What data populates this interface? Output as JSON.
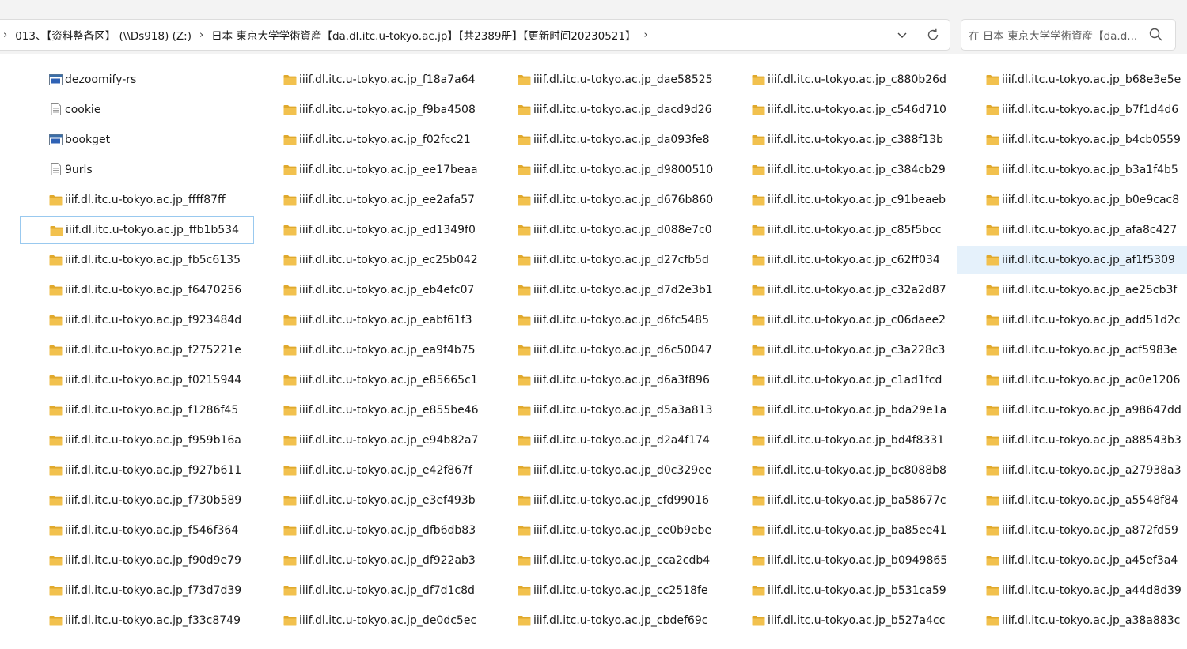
{
  "window": {
    "corner_mark": ""
  },
  "address": {
    "segments": [
      "013、【资料整备区】 (\\\\Ds918) (Z:)",
      "日本 東京大学学術資産【da.dl.itc.u-tokyo.ac.jp】【共2389册】【更新时间20230521】"
    ],
    "lead_sep": "›",
    "sep": "›",
    "trail_sep": "›"
  },
  "search": {
    "placeholder": "在 日本 東京大学学術資産【da.d..."
  },
  "colors": {
    "folder": "#f2c14e",
    "folder_dark": "#e0a92c",
    "hover_bg": "#e5f1fb",
    "focus_border": "#99c9ef"
  },
  "columns": [
    [
      {
        "name": "dezoomify-rs",
        "icon": "app-icon"
      },
      {
        "name": "cookie",
        "icon": "text-file-icon"
      },
      {
        "name": "bookget",
        "icon": "app-icon"
      },
      {
        "name": "9urls",
        "icon": "text-file-icon"
      },
      {
        "name": "iiif.dl.itc.u-tokyo.ac.jp_ffff87ff",
        "icon": "folder-icon"
      },
      {
        "name": "iiif.dl.itc.u-tokyo.ac.jp_ffb1b534",
        "icon": "folder-icon",
        "state": "focused"
      },
      {
        "name": "iiif.dl.itc.u-tokyo.ac.jp_fb5c6135",
        "icon": "folder-icon"
      },
      {
        "name": "iiif.dl.itc.u-tokyo.ac.jp_f6470256",
        "icon": "folder-icon"
      },
      {
        "name": "iiif.dl.itc.u-tokyo.ac.jp_f923484d",
        "icon": "folder-icon"
      },
      {
        "name": "iiif.dl.itc.u-tokyo.ac.jp_f275221e",
        "icon": "folder-icon"
      },
      {
        "name": "iiif.dl.itc.u-tokyo.ac.jp_f0215944",
        "icon": "folder-icon"
      },
      {
        "name": "iiif.dl.itc.u-tokyo.ac.jp_f1286f45",
        "icon": "folder-icon"
      },
      {
        "name": "iiif.dl.itc.u-tokyo.ac.jp_f959b16a",
        "icon": "folder-icon"
      },
      {
        "name": "iiif.dl.itc.u-tokyo.ac.jp_f927b611",
        "icon": "folder-icon"
      },
      {
        "name": "iiif.dl.itc.u-tokyo.ac.jp_f730b589",
        "icon": "folder-icon"
      },
      {
        "name": "iiif.dl.itc.u-tokyo.ac.jp_f546f364",
        "icon": "folder-icon"
      },
      {
        "name": "iiif.dl.itc.u-tokyo.ac.jp_f90d9e79",
        "icon": "folder-icon"
      },
      {
        "name": "iiif.dl.itc.u-tokyo.ac.jp_f73d7d39",
        "icon": "folder-icon"
      },
      {
        "name": "iiif.dl.itc.u-tokyo.ac.jp_f33c8749",
        "icon": "folder-icon"
      }
    ],
    [
      {
        "name": "iiif.dl.itc.u-tokyo.ac.jp_f18a7a64",
        "icon": "folder-icon"
      },
      {
        "name": "iiif.dl.itc.u-tokyo.ac.jp_f9ba4508",
        "icon": "folder-icon"
      },
      {
        "name": "iiif.dl.itc.u-tokyo.ac.jp_f02fcc21",
        "icon": "folder-icon"
      },
      {
        "name": "iiif.dl.itc.u-tokyo.ac.jp_ee17beaa",
        "icon": "folder-icon"
      },
      {
        "name": "iiif.dl.itc.u-tokyo.ac.jp_ee2afa57",
        "icon": "folder-icon"
      },
      {
        "name": "iiif.dl.itc.u-tokyo.ac.jp_ed1349f0",
        "icon": "folder-icon"
      },
      {
        "name": "iiif.dl.itc.u-tokyo.ac.jp_ec25b042",
        "icon": "folder-icon"
      },
      {
        "name": "iiif.dl.itc.u-tokyo.ac.jp_eb4efc07",
        "icon": "folder-icon"
      },
      {
        "name": "iiif.dl.itc.u-tokyo.ac.jp_eabf61f3",
        "icon": "folder-icon"
      },
      {
        "name": "iiif.dl.itc.u-tokyo.ac.jp_ea9f4b75",
        "icon": "folder-icon"
      },
      {
        "name": "iiif.dl.itc.u-tokyo.ac.jp_e85665c1",
        "icon": "folder-icon"
      },
      {
        "name": "iiif.dl.itc.u-tokyo.ac.jp_e855be46",
        "icon": "folder-icon"
      },
      {
        "name": "iiif.dl.itc.u-tokyo.ac.jp_e94b82a7",
        "icon": "folder-icon"
      },
      {
        "name": "iiif.dl.itc.u-tokyo.ac.jp_e42f867f",
        "icon": "folder-icon"
      },
      {
        "name": "iiif.dl.itc.u-tokyo.ac.jp_e3ef493b",
        "icon": "folder-icon"
      },
      {
        "name": "iiif.dl.itc.u-tokyo.ac.jp_dfb6db83",
        "icon": "folder-icon"
      },
      {
        "name": "iiif.dl.itc.u-tokyo.ac.jp_df922ab3",
        "icon": "folder-icon"
      },
      {
        "name": "iiif.dl.itc.u-tokyo.ac.jp_df7d1c8d",
        "icon": "folder-icon"
      },
      {
        "name": "iiif.dl.itc.u-tokyo.ac.jp_de0dc5ec",
        "icon": "folder-icon"
      }
    ],
    [
      {
        "name": "iiif.dl.itc.u-tokyo.ac.jp_dae58525",
        "icon": "folder-icon"
      },
      {
        "name": "iiif.dl.itc.u-tokyo.ac.jp_dacd9d26",
        "icon": "folder-icon"
      },
      {
        "name": "iiif.dl.itc.u-tokyo.ac.jp_da093fe8",
        "icon": "folder-icon"
      },
      {
        "name": "iiif.dl.itc.u-tokyo.ac.jp_d9800510",
        "icon": "folder-icon"
      },
      {
        "name": "iiif.dl.itc.u-tokyo.ac.jp_d676b860",
        "icon": "folder-icon"
      },
      {
        "name": "iiif.dl.itc.u-tokyo.ac.jp_d088e7c0",
        "icon": "folder-icon"
      },
      {
        "name": "iiif.dl.itc.u-tokyo.ac.jp_d27cfb5d",
        "icon": "folder-icon"
      },
      {
        "name": "iiif.dl.itc.u-tokyo.ac.jp_d7d2e3b1",
        "icon": "folder-icon"
      },
      {
        "name": "iiif.dl.itc.u-tokyo.ac.jp_d6fc5485",
        "icon": "folder-icon"
      },
      {
        "name": "iiif.dl.itc.u-tokyo.ac.jp_d6c50047",
        "icon": "folder-icon"
      },
      {
        "name": "iiif.dl.itc.u-tokyo.ac.jp_d6a3f896",
        "icon": "folder-icon"
      },
      {
        "name": "iiif.dl.itc.u-tokyo.ac.jp_d5a3a813",
        "icon": "folder-icon"
      },
      {
        "name": "iiif.dl.itc.u-tokyo.ac.jp_d2a4f174",
        "icon": "folder-icon"
      },
      {
        "name": "iiif.dl.itc.u-tokyo.ac.jp_d0c329ee",
        "icon": "folder-icon"
      },
      {
        "name": "iiif.dl.itc.u-tokyo.ac.jp_cfd99016",
        "icon": "folder-icon"
      },
      {
        "name": "iiif.dl.itc.u-tokyo.ac.jp_ce0b9ebe",
        "icon": "folder-icon"
      },
      {
        "name": "iiif.dl.itc.u-tokyo.ac.jp_cca2cdb4",
        "icon": "folder-icon"
      },
      {
        "name": "iiif.dl.itc.u-tokyo.ac.jp_cc2518fe",
        "icon": "folder-icon"
      },
      {
        "name": "iiif.dl.itc.u-tokyo.ac.jp_cbdef69c",
        "icon": "folder-icon"
      }
    ],
    [
      {
        "name": "iiif.dl.itc.u-tokyo.ac.jp_c880b26d",
        "icon": "folder-icon"
      },
      {
        "name": "iiif.dl.itc.u-tokyo.ac.jp_c546d710",
        "icon": "folder-icon"
      },
      {
        "name": "iiif.dl.itc.u-tokyo.ac.jp_c388f13b",
        "icon": "folder-icon"
      },
      {
        "name": "iiif.dl.itc.u-tokyo.ac.jp_c384cb29",
        "icon": "folder-icon"
      },
      {
        "name": "iiif.dl.itc.u-tokyo.ac.jp_c91beaeb",
        "icon": "folder-icon"
      },
      {
        "name": "iiif.dl.itc.u-tokyo.ac.jp_c85f5bcc",
        "icon": "folder-icon"
      },
      {
        "name": "iiif.dl.itc.u-tokyo.ac.jp_c62ff034",
        "icon": "folder-icon"
      },
      {
        "name": "iiif.dl.itc.u-tokyo.ac.jp_c32a2d87",
        "icon": "folder-icon"
      },
      {
        "name": "iiif.dl.itc.u-tokyo.ac.jp_c06daee2",
        "icon": "folder-icon"
      },
      {
        "name": "iiif.dl.itc.u-tokyo.ac.jp_c3a228c3",
        "icon": "folder-icon"
      },
      {
        "name": "iiif.dl.itc.u-tokyo.ac.jp_c1ad1fcd",
        "icon": "folder-icon"
      },
      {
        "name": "iiif.dl.itc.u-tokyo.ac.jp_bda29e1a",
        "icon": "folder-icon"
      },
      {
        "name": "iiif.dl.itc.u-tokyo.ac.jp_bd4f8331",
        "icon": "folder-icon"
      },
      {
        "name": "iiif.dl.itc.u-tokyo.ac.jp_bc8088b8",
        "icon": "folder-icon"
      },
      {
        "name": "iiif.dl.itc.u-tokyo.ac.jp_ba58677c",
        "icon": "folder-icon"
      },
      {
        "name": "iiif.dl.itc.u-tokyo.ac.jp_ba85ee41",
        "icon": "folder-icon"
      },
      {
        "name": "iiif.dl.itc.u-tokyo.ac.jp_b0949865",
        "icon": "folder-icon"
      },
      {
        "name": "iiif.dl.itc.u-tokyo.ac.jp_b531ca59",
        "icon": "folder-icon"
      },
      {
        "name": "iiif.dl.itc.u-tokyo.ac.jp_b527a4cc",
        "icon": "folder-icon"
      }
    ],
    [
      {
        "name": "iiif.dl.itc.u-tokyo.ac.jp_b68e3e5e",
        "icon": "folder-icon"
      },
      {
        "name": "iiif.dl.itc.u-tokyo.ac.jp_b7f1d4d6",
        "icon": "folder-icon"
      },
      {
        "name": "iiif.dl.itc.u-tokyo.ac.jp_b4cb0559",
        "icon": "folder-icon"
      },
      {
        "name": "iiif.dl.itc.u-tokyo.ac.jp_b3a1f4b5",
        "icon": "folder-icon"
      },
      {
        "name": "iiif.dl.itc.u-tokyo.ac.jp_b0e9cac8",
        "icon": "folder-icon"
      },
      {
        "name": "iiif.dl.itc.u-tokyo.ac.jp_afa8c427",
        "icon": "folder-icon"
      },
      {
        "name": "iiif.dl.itc.u-tokyo.ac.jp_af1f5309",
        "icon": "folder-icon",
        "state": "hovered"
      },
      {
        "name": "iiif.dl.itc.u-tokyo.ac.jp_ae25cb3f",
        "icon": "folder-icon"
      },
      {
        "name": "iiif.dl.itc.u-tokyo.ac.jp_add51d2c",
        "icon": "folder-icon"
      },
      {
        "name": "iiif.dl.itc.u-tokyo.ac.jp_acf5983e",
        "icon": "folder-icon"
      },
      {
        "name": "iiif.dl.itc.u-tokyo.ac.jp_ac0e1206",
        "icon": "folder-icon"
      },
      {
        "name": "iiif.dl.itc.u-tokyo.ac.jp_a98647dd",
        "icon": "folder-icon"
      },
      {
        "name": "iiif.dl.itc.u-tokyo.ac.jp_a88543b3",
        "icon": "folder-icon"
      },
      {
        "name": "iiif.dl.itc.u-tokyo.ac.jp_a27938a3",
        "icon": "folder-icon"
      },
      {
        "name": "iiif.dl.itc.u-tokyo.ac.jp_a5548f84",
        "icon": "folder-icon"
      },
      {
        "name": "iiif.dl.itc.u-tokyo.ac.jp_a872fd59",
        "icon": "folder-icon"
      },
      {
        "name": "iiif.dl.itc.u-tokyo.ac.jp_a45ef3a4",
        "icon": "folder-icon"
      },
      {
        "name": "iiif.dl.itc.u-tokyo.ac.jp_a44d8d39",
        "icon": "folder-icon"
      },
      {
        "name": "iiif.dl.itc.u-tokyo.ac.jp_a38a883c",
        "icon": "folder-icon"
      }
    ]
  ]
}
